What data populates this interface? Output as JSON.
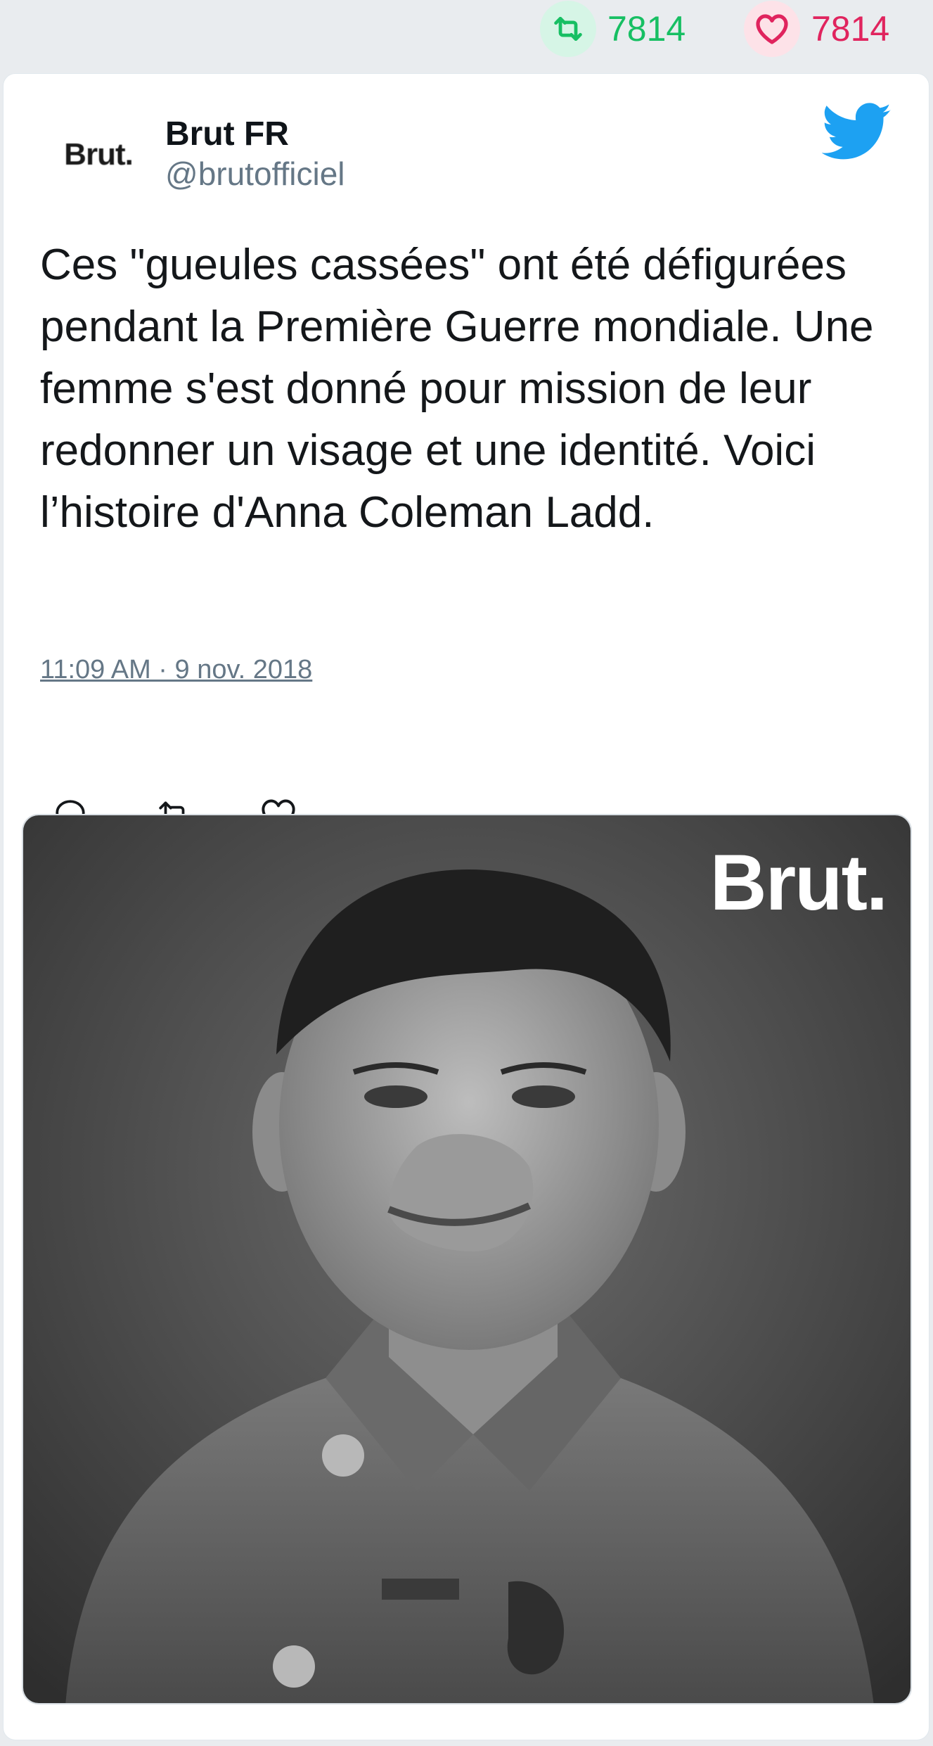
{
  "stats": {
    "retweets": "7814",
    "likes": "7814",
    "retweet_color": "#17bf63",
    "like_color": "#e0245e"
  },
  "tweet": {
    "avatar_text": "Brut.",
    "author_name": "Brut FR",
    "author_handle": "@brutofficiel",
    "text": "Ces \"gueules cassées\" ont été défigurées pendant la Première Guerre mondiale. Une femme s'est donné pour mission de leur redonner un visage et une identité. Voici l’histoire d'Anna Coleman Ladd.",
    "timestamp": "11:09 AM · 9 nov. 2018",
    "actions": [
      "reply-icon",
      "retweet-icon",
      "like-icon"
    ],
    "platform_icon": "twitter-bird-icon",
    "platform_color": "#1da1f2"
  },
  "media": {
    "watermark": "Brut."
  }
}
